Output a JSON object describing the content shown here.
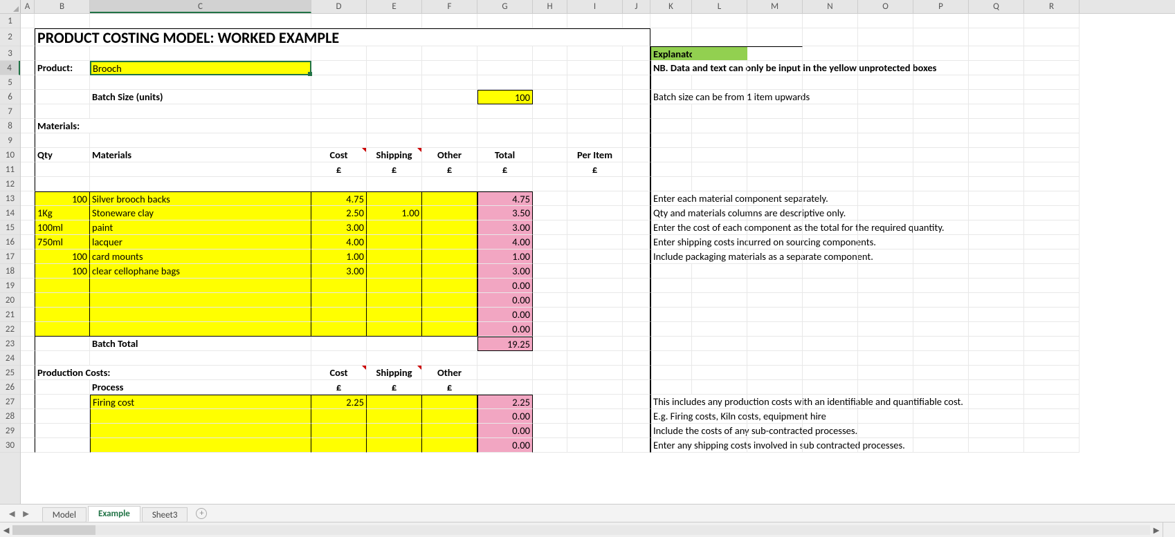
{
  "columns": [
    "A",
    "B",
    "C",
    "D",
    "E",
    "F",
    "G",
    "H",
    "I",
    "J",
    "K",
    "L",
    "M",
    "N",
    "O",
    "P",
    "Q",
    "R"
  ],
  "selectedCol": "C",
  "selectedRow": 4,
  "rows": 30,
  "title": "PRODUCT COSTING MODEL:   WORKED EXAMPLE",
  "labels": {
    "product": "Product:",
    "productValue": "Brooch",
    "batchSize": "Batch Size (units)",
    "batchSizeValue": "100",
    "materialsHdr": "Materials:",
    "qty": "Qty",
    "materials": "Materials",
    "cost": "Cost",
    "shipping": "Shipping",
    "other": "Other",
    "total": "Total",
    "perItem": "Per Item",
    "gbp": "£",
    "batchTotal": "Batch Total",
    "batchTotalValue": "19.25",
    "prodCosts": "Production Costs:",
    "process": "Process"
  },
  "materialRows": [
    {
      "qty": "100",
      "mat": "Silver brooch backs",
      "cost": "4.75",
      "ship": "",
      "other": "",
      "total": "4.75"
    },
    {
      "qty": "1Kg",
      "mat": "Stoneware clay",
      "cost": "2.50",
      "ship": "1.00",
      "other": "",
      "total": "3.50"
    },
    {
      "qty": "100ml",
      "mat": "paint",
      "cost": "3.00",
      "ship": "",
      "other": "",
      "total": "3.00"
    },
    {
      "qty": "750ml",
      "mat": "lacquer",
      "cost": "4.00",
      "ship": "",
      "other": "",
      "total": "4.00"
    },
    {
      "qty": "100",
      "mat": "card mounts",
      "cost": "1.00",
      "ship": "",
      "other": "",
      "total": "1.00"
    },
    {
      "qty": "100",
      "mat": "clear cellophane bags",
      "cost": "3.00",
      "ship": "",
      "other": "",
      "total": "3.00"
    },
    {
      "qty": "",
      "mat": "",
      "cost": "",
      "ship": "",
      "other": "",
      "total": "0.00"
    },
    {
      "qty": "",
      "mat": "",
      "cost": "",
      "ship": "",
      "other": "",
      "total": "0.00"
    },
    {
      "qty": "",
      "mat": "",
      "cost": "",
      "ship": "",
      "other": "",
      "total": "0.00"
    },
    {
      "qty": "",
      "mat": "",
      "cost": "",
      "ship": "",
      "other": "",
      "total": "0.00"
    }
  ],
  "processRows": [
    {
      "proc": "Firing cost",
      "cost": "2.25",
      "ship": "",
      "other": "",
      "total": "2.25"
    },
    {
      "proc": "",
      "cost": "",
      "ship": "",
      "other": "",
      "total": "0.00"
    },
    {
      "proc": "",
      "cost": "",
      "ship": "",
      "other": "",
      "total": "0.00"
    },
    {
      "proc": "",
      "cost": "",
      "ship": "",
      "other": "",
      "total": "0.00"
    }
  ],
  "notes": {
    "hdr": "Explanatory Notes:",
    "nb": "NB. Data and text can only be input in the yellow unprotected boxes",
    "r6": "Batch size can be from 1 item upwards",
    "r13": "Enter each material component separately.",
    "r14": "Qty and materials columns are descriptive only.",
    "r15": "Enter the cost of each component as the total for the required quantity.",
    "r16": "Enter shipping costs incurred on sourcing components.",
    "r17": "Include packaging materials as a separate component.",
    "r27": "This includes any production costs with an identifiable and quantifiable cost.",
    "r28": "E.g.  Firing costs, Kiln costs, equipment hire",
    "r29": "Include the costs of any sub-contracted processes.",
    "r30": "Enter any shipping costs involved in sub contracted processes."
  },
  "tabs": {
    "list": [
      "Model",
      "Example",
      "Sheet3"
    ],
    "active": "Example"
  }
}
